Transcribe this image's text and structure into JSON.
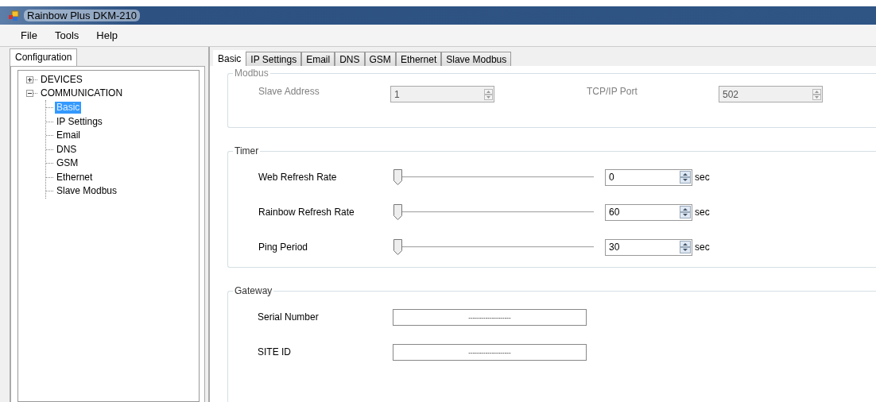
{
  "window": {
    "title": "Rainbow Plus DKM-210"
  },
  "menu": [
    "File",
    "Tools",
    "Help"
  ],
  "left_tabs": [
    {
      "label": "Configuration",
      "selected": true
    }
  ],
  "tree": [
    {
      "label": "DEVICES",
      "expanded": false,
      "selected": false
    },
    {
      "label": "COMMUNICATION",
      "expanded": true,
      "selected": false,
      "children": [
        {
          "label": "Basic",
          "selected": true
        },
        {
          "label": "IP Settings",
          "selected": false
        },
        {
          "label": "Email",
          "selected": false
        },
        {
          "label": "DNS",
          "selected": false
        },
        {
          "label": "GSM",
          "selected": false
        },
        {
          "label": "Ethernet",
          "selected": false
        },
        {
          "label": "Slave Modbus",
          "selected": false
        }
      ]
    }
  ],
  "tabs": [
    {
      "label": "Basic",
      "selected": true
    },
    {
      "label": "IP Settings",
      "selected": false
    },
    {
      "label": "Email",
      "selected": false
    },
    {
      "label": "DNS",
      "selected": false
    },
    {
      "label": "GSM",
      "selected": false
    },
    {
      "label": "Ethernet",
      "selected": false
    },
    {
      "label": "Slave Modbus",
      "selected": false
    }
  ],
  "modbus": {
    "title": "Modbus",
    "disabled": true,
    "fields": [
      {
        "label": "Slave Address",
        "value": "1"
      },
      {
        "label": "TCP/IP Port",
        "value": "502"
      }
    ]
  },
  "timer": {
    "title": "Timer",
    "rows": [
      {
        "label": "Web Refresh Rate",
        "level": 0,
        "value": "0",
        "unit": "sec"
      },
      {
        "label": "Rainbow Refresh Rate",
        "level": 0,
        "value": "60",
        "unit": "sec"
      },
      {
        "label": "Ping Period",
        "level": 0,
        "value": "30",
        "unit": "sec"
      }
    ]
  },
  "gateway": {
    "title": "Gateway",
    "fields": [
      {
        "label": "Serial Number",
        "value": "--------------------"
      },
      {
        "label": "SITE ID",
        "value": "--------------------"
      }
    ]
  }
}
